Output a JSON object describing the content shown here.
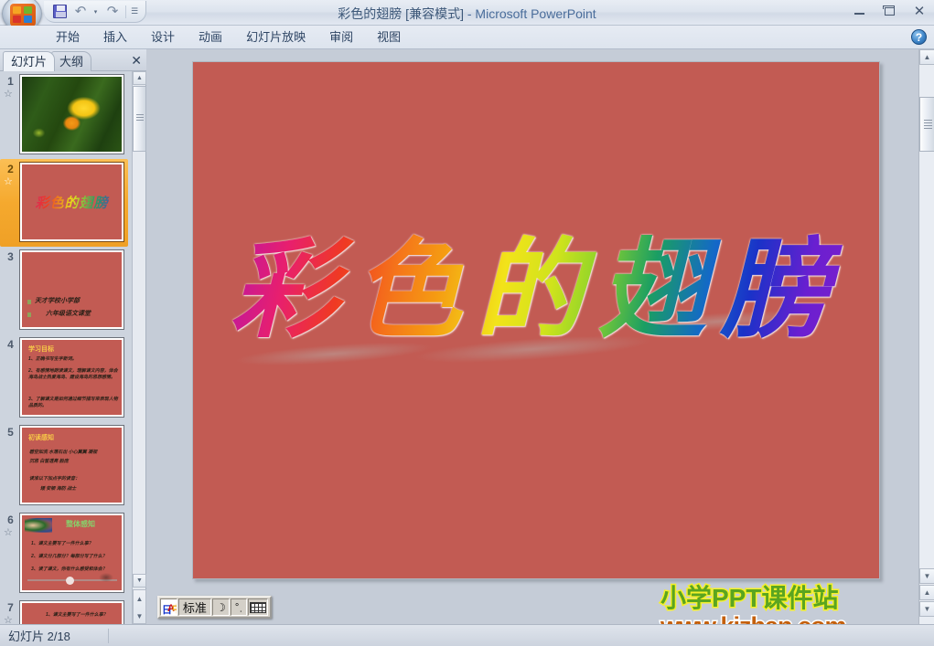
{
  "window": {
    "title_main": "彩色的翅膀 [兼容模式]",
    "title_sep": " - ",
    "title_app": "Microsoft PowerPoint",
    "minimize": "–",
    "restore": "❐",
    "close": "✕"
  },
  "quick_access": {
    "office_button": "office-orb",
    "save": "save-icon",
    "undo": "↶",
    "undo_caret": "▾",
    "redo": "↷",
    "customize": "☰"
  },
  "ribbon": {
    "tabs": [
      {
        "label": "开始"
      },
      {
        "label": "插入"
      },
      {
        "label": "设计"
      },
      {
        "label": "动画"
      },
      {
        "label": "幻灯片放映"
      },
      {
        "label": "审阅"
      },
      {
        "label": "视图"
      }
    ],
    "help": "?"
  },
  "left_panel": {
    "tabs": [
      {
        "label": "幻灯片",
        "active": true
      },
      {
        "label": "大纲",
        "active": false
      }
    ],
    "close": "✕",
    "scroll_up": "▲",
    "scroll_down": "▼",
    "prev_slide": "▲",
    "next_slide": "▼",
    "slides": [
      {
        "number": "1",
        "kind": "photo",
        "title": "",
        "lines": []
      },
      {
        "number": "2",
        "kind": "wordart",
        "title": "彩色的翅膀",
        "lines": [],
        "selected": true
      },
      {
        "number": "3",
        "kind": "bullets",
        "title": "",
        "lines": [
          "天才学校小学部",
          "六年级语文课堂"
        ]
      },
      {
        "number": "4",
        "kind": "bullets",
        "title": "学习目标",
        "lines": [
          "1、正确书写生字新词。",
          "2、有感情地朗读课文，理解课文内容，体会海岛战士热爱海岛、建设海岛的思想感情。",
          "3、了解课文是如何通过细节描写来表现人物品质的。"
        ]
      },
      {
        "number": "5",
        "kind": "bullets",
        "title": "初读感知",
        "lines": [
          "碧空如洗  水落石出  小心翼翼  凝视",
          "沉思  白皙透亮  脸庞",
          "",
          "读准以下加点字的读音：",
          "矮  安顿  海防  战士"
        ]
      },
      {
        "number": "6",
        "kind": "bullets-img",
        "title": "整体感知",
        "lines": [
          "1、课文主要写了一件什么事？",
          "2、课文分几部分？每部分写了什么？",
          "3、读了课文，你有什么感受和体会？"
        ]
      },
      {
        "number": "7",
        "kind": "bullets",
        "title": "",
        "lines": [
          "1、课文主要写了一件什么事？"
        ]
      }
    ]
  },
  "slide": {
    "background_color": "#C25B53",
    "wordart_text": "彩色的翅膀",
    "wordart_colors": [
      "#c2189a",
      "#ef3a22",
      "#f2e31a",
      "#1a9e63",
      "#6a1fd0"
    ]
  },
  "ime_bar": {
    "logo": "ime-logo-icon",
    "mode": "标准",
    "moon": "☽",
    "punctuation": "°ˌ",
    "keyboard": "keyboard-icon"
  },
  "status_bar": {
    "slide_counter": "幻灯片 2/18"
  },
  "watermark": {
    "line1": "小学PPT课件站",
    "line2": "www.kjzhan.com"
  },
  "main_scroll": {
    "up": "▲",
    "down": "▼",
    "prev": "▲",
    "next": "▼",
    "slideshow": "□"
  }
}
